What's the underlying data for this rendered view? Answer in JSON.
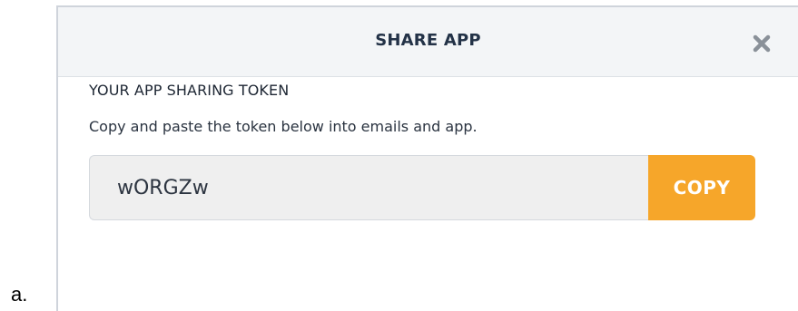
{
  "list_marker": "a.",
  "modal": {
    "title": "SHARE APP",
    "close_icon": "close-icon"
  },
  "token_section": {
    "heading": "YOUR APP SHARING TOKEN",
    "description": "Copy and paste the token below into emails and app.",
    "token_value": "wORGZw",
    "copy_label": "COPY"
  },
  "colors": {
    "header_bg": "#f3f5f7",
    "title_text": "#233247",
    "input_bg": "#efefef",
    "copy_button_bg": "#f6a62a",
    "close_icon": "#8a9199"
  }
}
